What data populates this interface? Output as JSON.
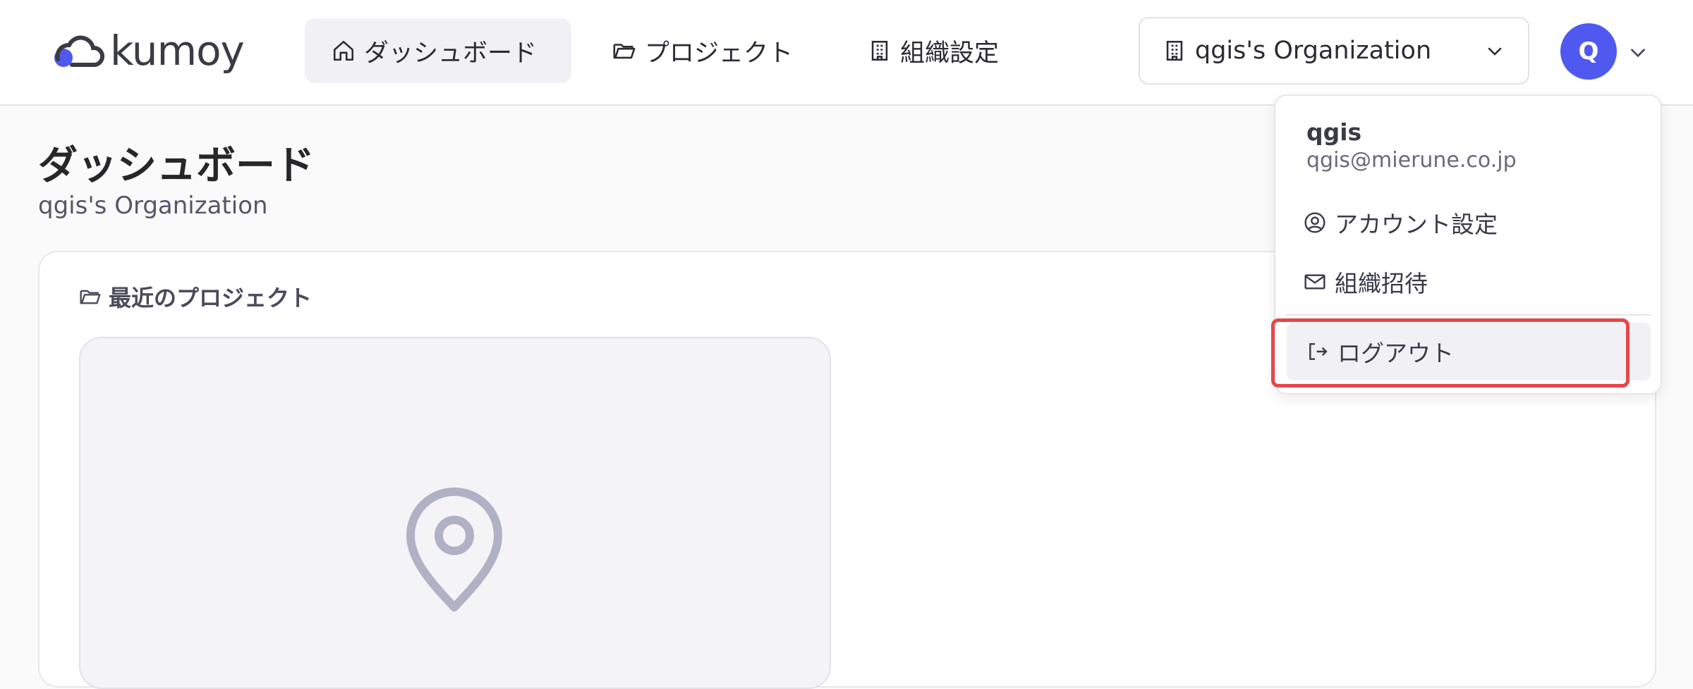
{
  "app": {
    "name": "kumoy",
    "brand_color": "#4f59f0"
  },
  "nav": {
    "items": [
      {
        "label": "ダッシュボード",
        "icon": "home-icon",
        "active": true
      },
      {
        "label": "プロジェクト",
        "icon": "folder-icon",
        "active": false
      },
      {
        "label": "組織設定",
        "icon": "building-icon",
        "active": false
      }
    ]
  },
  "org_select": {
    "value": "qgis's Organization",
    "icon": "building-icon"
  },
  "avatar": {
    "initial": "Q"
  },
  "page": {
    "title": "ダッシュボード",
    "subtitle": "qgis's Organization"
  },
  "recent": {
    "title": "最近のプロジェクト",
    "icon": "folder-icon"
  },
  "user_menu": {
    "name": "qgis",
    "email": "qgis@mierune.co.jp",
    "items": [
      {
        "label": "アカウント設定",
        "icon": "user-circle-icon"
      },
      {
        "label": "組織招待",
        "icon": "mail-icon"
      }
    ],
    "logout": {
      "label": "ログアウト",
      "icon": "logout-icon"
    },
    "highlight_color": "#e8464a"
  }
}
